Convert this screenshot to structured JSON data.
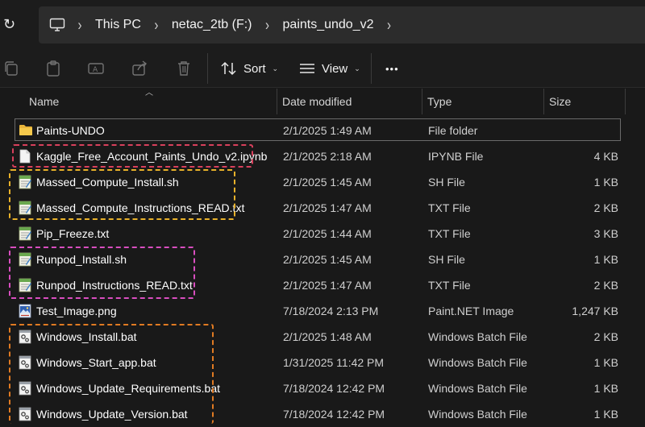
{
  "breadcrumb": [
    "This PC",
    "netac_2tb (F:)",
    "paints_undo_v2"
  ],
  "toolbar": {
    "sort_label": "Sort",
    "view_label": "View",
    "more_label": "•••"
  },
  "columns": {
    "name": "Name",
    "date": "Date modified",
    "type": "Type",
    "size": "Size"
  },
  "files": [
    {
      "name": "Paints-UNDO",
      "date": "2/1/2025 1:49 AM",
      "type": "File folder",
      "size": "",
      "icon": "folder-icon"
    },
    {
      "name": "Kaggle_Free_Account_Paints_Undo_v2.ipynb",
      "date": "2/1/2025 2:18 AM",
      "type": "IPYNB File",
      "size": "4 KB",
      "icon": "blank-file-icon"
    },
    {
      "name": "Massed_Compute_Install.sh",
      "date": "2/1/2025 1:45 AM",
      "type": "SH File",
      "size": "1 KB",
      "icon": "text-file-icon"
    },
    {
      "name": "Massed_Compute_Instructions_READ.txt",
      "date": "2/1/2025 1:47 AM",
      "type": "TXT File",
      "size": "2 KB",
      "icon": "text-file-icon"
    },
    {
      "name": "Pip_Freeze.txt",
      "date": "2/1/2025 1:44 AM",
      "type": "TXT File",
      "size": "3 KB",
      "icon": "text-file-icon"
    },
    {
      "name": "Runpod_Install.sh",
      "date": "2/1/2025 1:45 AM",
      "type": "SH File",
      "size": "1 KB",
      "icon": "text-file-icon"
    },
    {
      "name": "Runpod_Instructions_READ.txt",
      "date": "2/1/2025 1:47 AM",
      "type": "TXT File",
      "size": "2 KB",
      "icon": "text-file-icon"
    },
    {
      "name": "Test_Image.png",
      "date": "7/18/2024 2:13 PM",
      "type": "Paint.NET Image",
      "size": "1,247 KB",
      "icon": "image-file-icon"
    },
    {
      "name": "Windows_Install.bat",
      "date": "2/1/2025 1:48 AM",
      "type": "Windows Batch File",
      "size": "2 KB",
      "icon": "batch-file-icon"
    },
    {
      "name": "Windows_Start_app.bat",
      "date": "1/31/2025 11:42 PM",
      "type": "Windows Batch File",
      "size": "1 KB",
      "icon": "batch-file-icon"
    },
    {
      "name": "Windows_Update_Requirements.bat",
      "date": "7/18/2024 12:42 PM",
      "type": "Windows Batch File",
      "size": "1 KB",
      "icon": "batch-file-icon"
    },
    {
      "name": "Windows_Update_Version.bat",
      "date": "7/18/2024 12:42 PM",
      "type": "Windows Batch File",
      "size": "1 KB",
      "icon": "batch-file-icon"
    }
  ],
  "highlight_colors": {
    "kaggle": "#d8405c",
    "massed_compute": "#e8b12a",
    "runpod": "#d94ec0",
    "windows": "#e07a22"
  },
  "theme": {
    "background": "#191919",
    "address_bar": "#2c2c2c",
    "folder": "#e8b43a"
  }
}
